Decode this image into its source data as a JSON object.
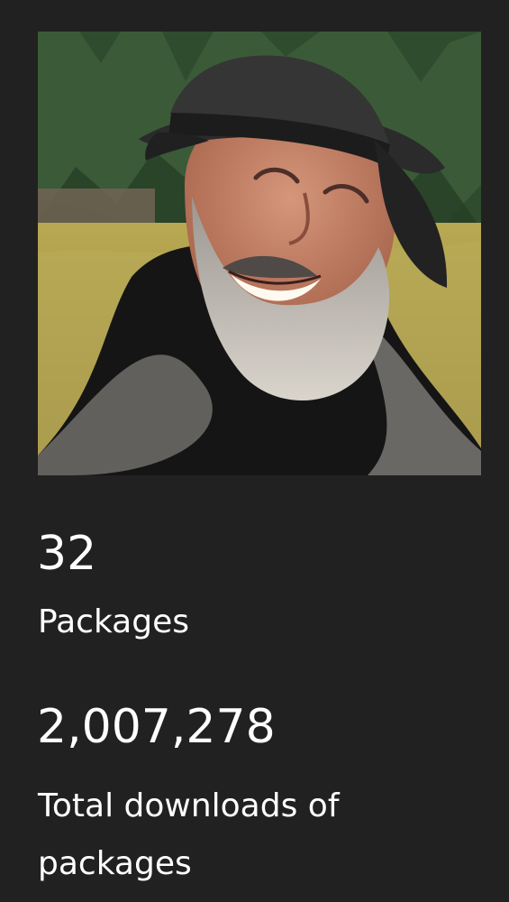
{
  "profile": {
    "packages": {
      "count": "32",
      "label": "Packages"
    },
    "downloads": {
      "count": "2,007,278",
      "label": "Total downloads of packages"
    }
  },
  "colors": {
    "background": "#212121",
    "text": "#ffffff"
  }
}
